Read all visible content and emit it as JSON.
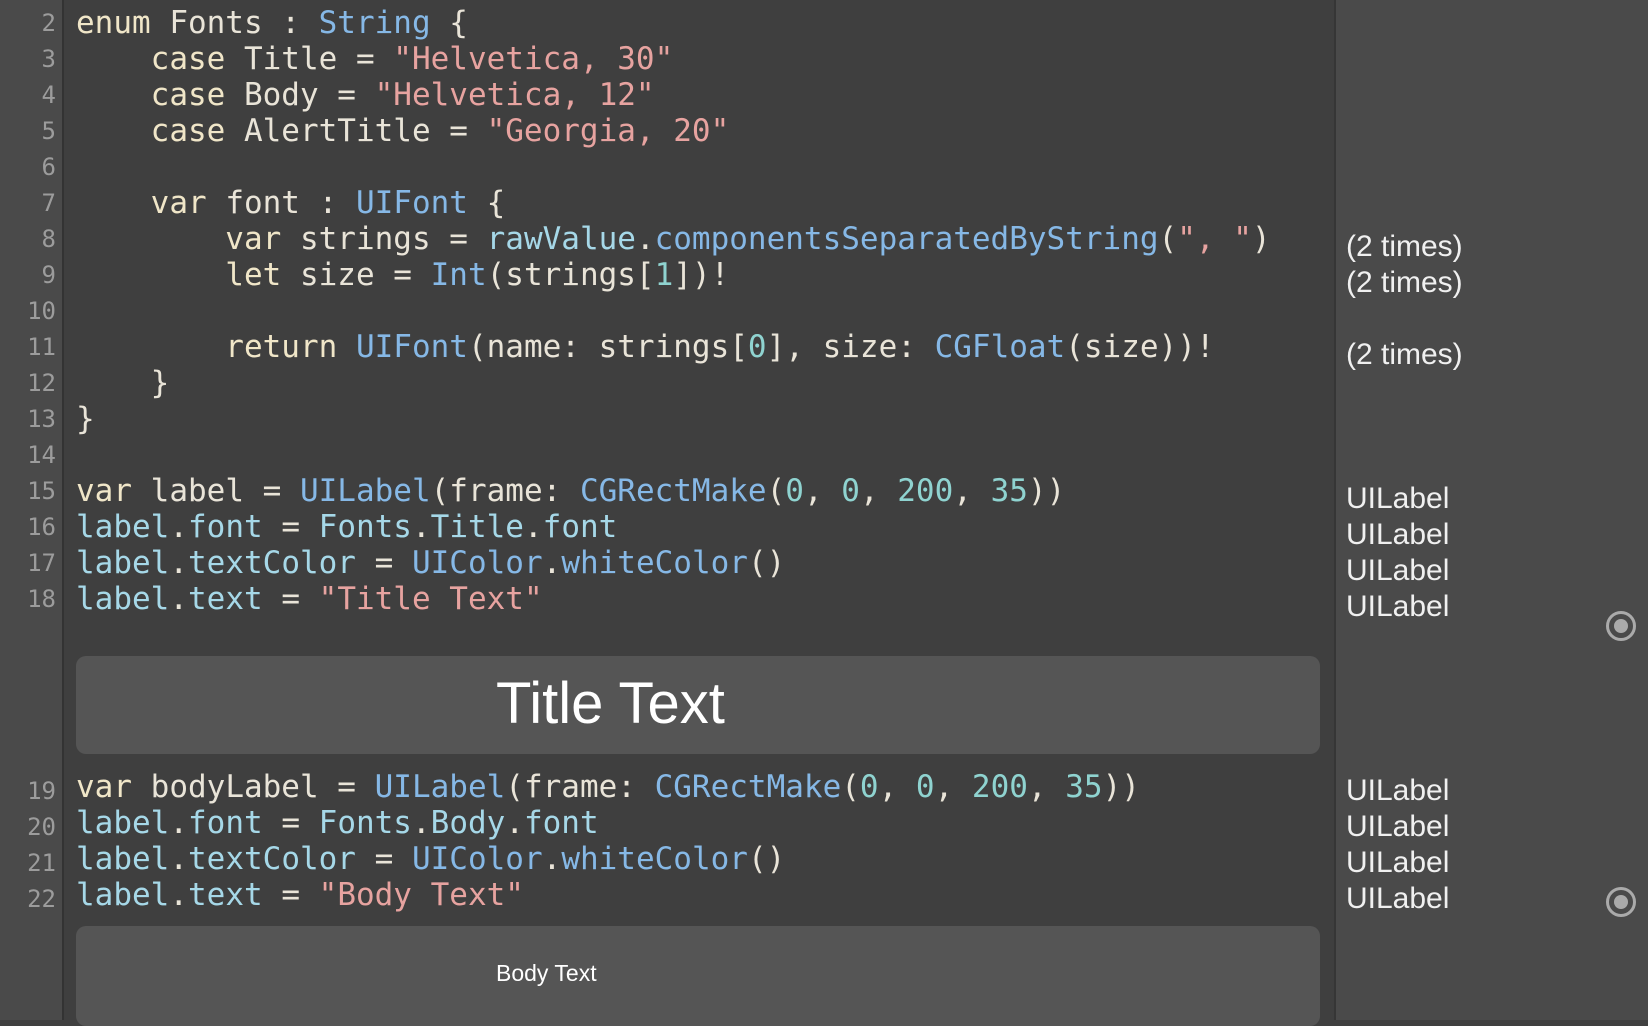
{
  "gutter": {
    "line_numbers": [
      "2",
      "3",
      "4",
      "5",
      "6",
      "7",
      "8",
      "9",
      "10",
      "11",
      "12",
      "13",
      "14",
      "15",
      "16",
      "17",
      "18",
      "19",
      "20",
      "21",
      "22"
    ]
  },
  "code": {
    "l2": [
      "enum",
      " Fonts ",
      ": ",
      "String",
      " {"
    ],
    "l3": [
      "    case",
      " Title = ",
      "\"Helvetica, 30\""
    ],
    "l4": [
      "    case",
      " Body = ",
      "\"Helvetica, 12\""
    ],
    "l5": [
      "    case",
      " AlertTitle = ",
      "\"Georgia, 20\""
    ],
    "l7": [
      "    var",
      " font : ",
      "UIFont",
      " {"
    ],
    "l8": [
      "        var",
      " strings = ",
      "rawValue",
      ".",
      "componentsSeparatedByString",
      "(",
      "\", \"",
      ")"
    ],
    "l9": [
      "        let",
      " size = ",
      "Int",
      "(strings[",
      "1",
      "])!"
    ],
    "l11": [
      "        return ",
      "UIFont",
      "(name: strings[",
      "0",
      "], size: ",
      "CGFloat",
      "(size))!"
    ],
    "l12": [
      "    }"
    ],
    "l13": [
      "}"
    ],
    "l15": [
      "var",
      " label = ",
      "UILabel",
      "(frame: ",
      "CGRectMake",
      "(",
      "0",
      ", ",
      "0",
      ", ",
      "200",
      ", ",
      "35",
      "))"
    ],
    "l16": [
      "label",
      ".",
      "font",
      " = ",
      "Fonts",
      ".",
      "Title",
      ".",
      "font"
    ],
    "l17": [
      "label",
      ".",
      "textColor",
      " = ",
      "UIColor",
      ".",
      "whiteColor",
      "()"
    ],
    "l18": [
      "label",
      ".",
      "text",
      " = ",
      "\"Title Text\""
    ],
    "l19": [
      "var",
      " bodyLabel = ",
      "UILabel",
      "(frame: ",
      "CGRectMake",
      "(",
      "0",
      ", ",
      "0",
      ", ",
      "200",
      ", ",
      "35",
      "))"
    ],
    "l20": [
      "label",
      ".",
      "font",
      " = ",
      "Fonts",
      ".",
      "Body",
      ".",
      "font"
    ],
    "l21": [
      "label",
      ".",
      "textColor",
      " = ",
      "UIColor",
      ".",
      "whiteColor",
      "()"
    ],
    "l22": [
      "label",
      ".",
      "text",
      " = ",
      "\"Body Text\""
    ]
  },
  "results": {
    "r8": "(2 times)",
    "r9": "(2 times)",
    "r11": "(2 times)",
    "r15": "UILabel",
    "r16": "UILabel",
    "r17": "UILabel",
    "r18": "UILabel",
    "r19": "UILabel",
    "r20": "UILabel",
    "r21": "UILabel",
    "r22": "UILabel"
  },
  "previews": {
    "title_text": "Title Text",
    "body_text": "Body Text"
  },
  "icons": {
    "quick_look": "quick-look-icon"
  },
  "colors": {
    "keyword": "#f0e6c8",
    "type": "#86b8e6",
    "string": "#e7a3a0",
    "number": "#8fd3d0",
    "background": "#3f3f3f",
    "gutter": "#4a4a4a"
  }
}
